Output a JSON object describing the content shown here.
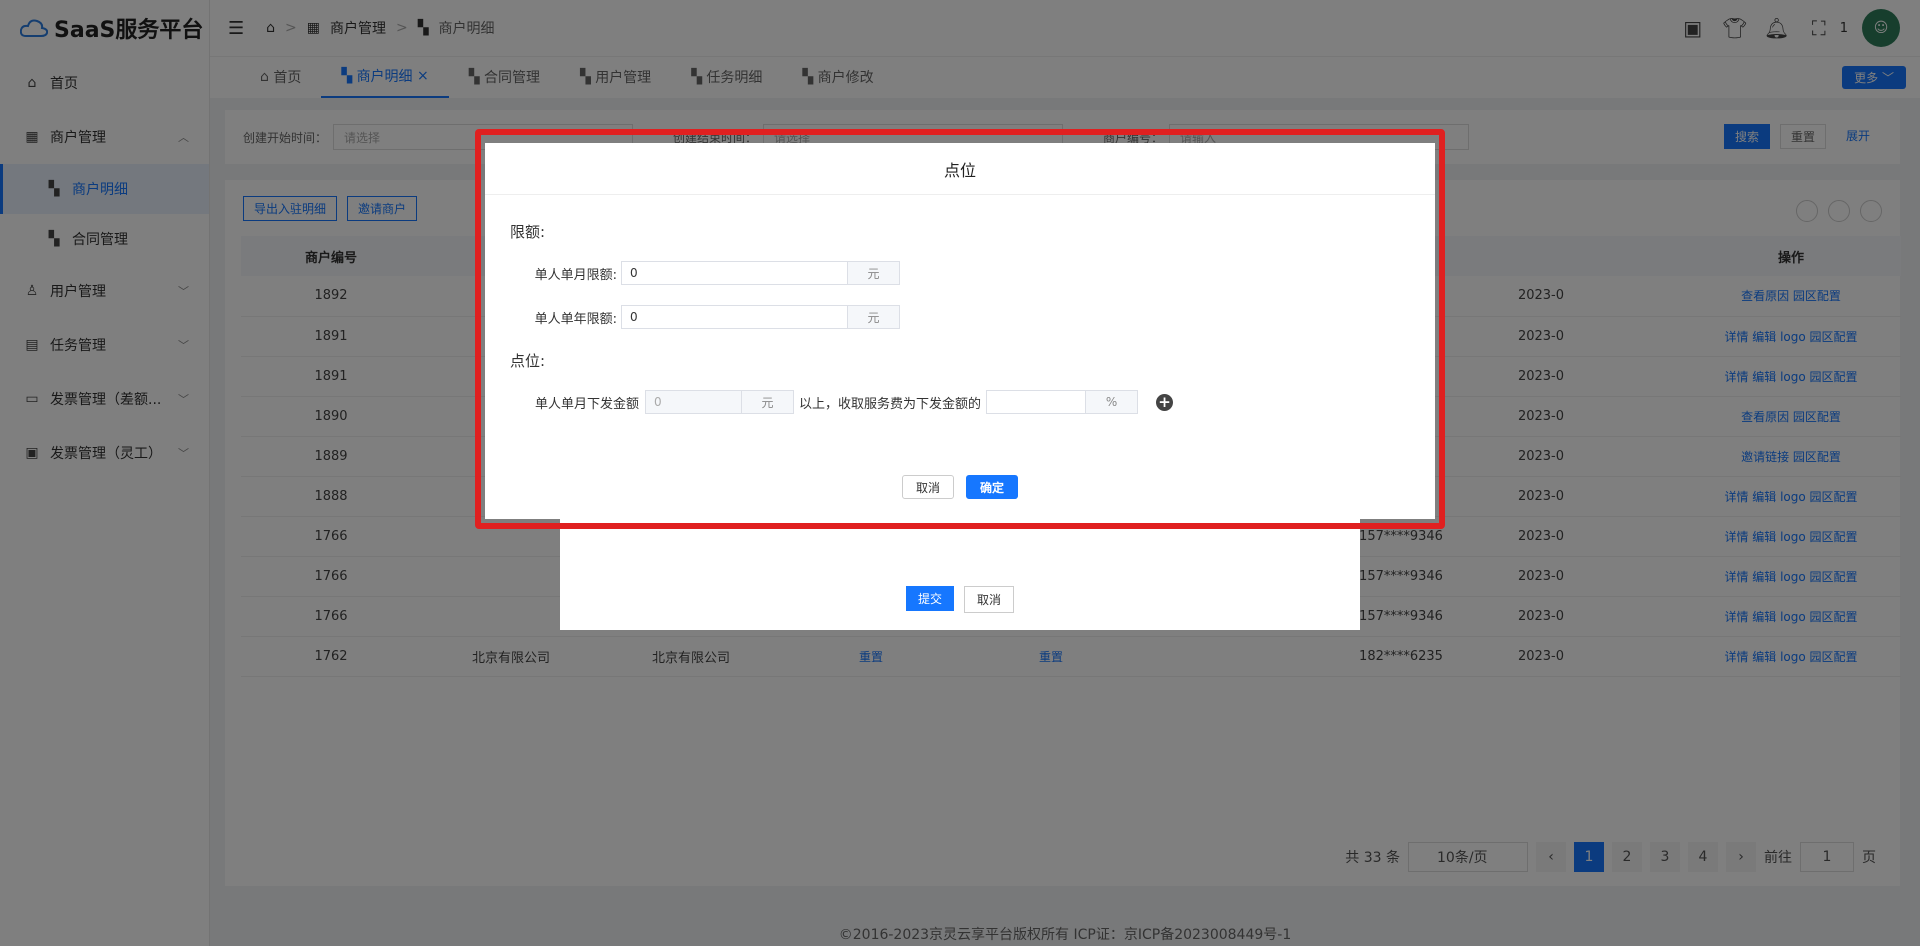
{
  "app": {
    "title": "SaaS服务平台"
  },
  "sidebar": {
    "items": [
      {
        "label": "首页",
        "icon": "home-icon"
      },
      {
        "label": "商户管理",
        "icon": "store-icon",
        "expanded": true
      },
      {
        "label": "商户明细",
        "icon": "grid-icon",
        "active": true,
        "sub": true
      },
      {
        "label": "合同管理",
        "icon": "grid-icon",
        "sub": true
      },
      {
        "label": "用户管理",
        "icon": "user-icon"
      },
      {
        "label": "任务管理",
        "icon": "task-icon"
      },
      {
        "label": "发票管理（差额...",
        "icon": "invoice-icon"
      },
      {
        "label": "发票管理（灵工）",
        "icon": "invoice2-icon"
      }
    ]
  },
  "header": {
    "breadcrumb": [
      "商户管理",
      "商户明细"
    ],
    "badge": "1"
  },
  "tabs": [
    {
      "label": "首页"
    },
    {
      "label": "商户明细",
      "active": true
    },
    {
      "label": "合同管理"
    },
    {
      "label": "用户管理"
    },
    {
      "label": "任务明细"
    },
    {
      "label": "商户修改"
    }
  ],
  "tabs_more": "更多",
  "filters": {
    "start_label": "创建开始时间：",
    "start_placeholder": "请选择",
    "end_label": "创建结束时间：",
    "end_placeholder": "请选择",
    "merchant_label": "商户编号：",
    "merchant_placeholder": "请输入",
    "search": "搜索",
    "reset": "重置",
    "expand": "展开"
  },
  "toolbar": {
    "export": "导出入驻明细",
    "invite": "邀请商户"
  },
  "table": {
    "headers": [
      "商户编号",
      "",
      "",
      "",
      "",
      "",
      "",
      "",
      "",
      "操作"
    ],
    "rows": [
      {
        "id": "1892",
        "phone": "",
        "date": "2023-0",
        "actions": "查看原因   园区配置"
      },
      {
        "id": "1891",
        "phone": "",
        "date": "2023-0",
        "actions": "详情  编辑  logo  园区配置"
      },
      {
        "id": "1891",
        "phone": "",
        "date": "2023-0",
        "actions": "详情  编辑  logo  园区配置"
      },
      {
        "id": "1890",
        "phone": "",
        "date": "2023-0",
        "actions": "查看原因   园区配置"
      },
      {
        "id": "1889",
        "phone": "",
        "date": "2023-0",
        "actions": "邀请链接   园区配置"
      },
      {
        "id": "1888",
        "phone": "",
        "date": "2023-0",
        "actions": "详情  编辑  logo  园区配置"
      },
      {
        "id": "1766",
        "phone": "157****9346",
        "date": "2023-0",
        "actions": "详情  编辑  logo  园区配置"
      },
      {
        "id": "1766",
        "phone": "157****9346",
        "date": "2023-0",
        "actions": "详情  编辑  logo  园区配置"
      },
      {
        "id": "1766",
        "phone": "157****9346",
        "date": "2023-0",
        "actions": "详情  编辑  logo  园区配置"
      },
      {
        "id": "1762",
        "phone": "182****6235",
        "date": "2023-0",
        "actions": "详情  编辑  logo  园区配置",
        "company1": "北京有限公司",
        "company2": "北京有限公司",
        "reset1": "重置",
        "reset2": "重置"
      }
    ]
  },
  "pagination": {
    "total": "共 33 条",
    "page_size": "10条/页",
    "pages": [
      "1",
      "2",
      "3",
      "4"
    ],
    "goto_label": "前往",
    "goto_value": "1",
    "page_suffix": "页"
  },
  "footer": "©2016-2023京灵云享平台版权所有 ICP证：京ICP备2023008449号-1",
  "under_dialog": {
    "submit": "提交",
    "cancel": "取消"
  },
  "dialog": {
    "title": "点位",
    "limit_section": "限额:",
    "monthly_label": "单人单月限额:",
    "monthly_value": "0",
    "yearly_label": "单人单年限额:",
    "yearly_value": "0",
    "unit_yuan": "元",
    "point_section": "点位:",
    "point_label": "单人单月下发金额",
    "point_amount_placeholder": "0",
    "point_mid": "以上，收取服务费为下发金额的",
    "point_rate_value": "",
    "unit_percent": "%",
    "cancel": "取消",
    "confirm": "确定"
  },
  "colors": {
    "accent": "#1677ff",
    "highlight": "#e02020"
  }
}
